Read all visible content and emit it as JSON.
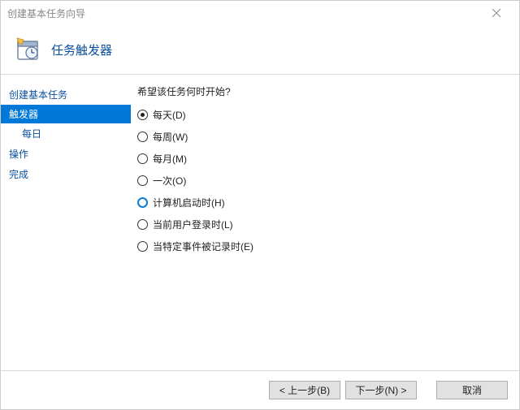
{
  "titlebar": {
    "title": "创建基本任务向导"
  },
  "header": {
    "heading": "任务触发器",
    "icon_name": "scheduled-task-icon"
  },
  "sidebar": {
    "steps": [
      {
        "label": "创建基本任务",
        "active": false,
        "sub": false
      },
      {
        "label": "触发器",
        "active": true,
        "sub": false
      },
      {
        "label": "每日",
        "active": false,
        "sub": true
      },
      {
        "label": "操作",
        "active": false,
        "sub": false
      },
      {
        "label": "完成",
        "active": false,
        "sub": false
      }
    ]
  },
  "main": {
    "prompt": "希望该任务何时开始?",
    "options": [
      {
        "label": "每天(D)",
        "checked": true,
        "hovered": false
      },
      {
        "label": "每周(W)",
        "checked": false,
        "hovered": false
      },
      {
        "label": "每月(M)",
        "checked": false,
        "hovered": false
      },
      {
        "label": "一次(O)",
        "checked": false,
        "hovered": false
      },
      {
        "label": "计算机启动时(H)",
        "checked": false,
        "hovered": true
      },
      {
        "label": "当前用户登录时(L)",
        "checked": false,
        "hovered": false
      },
      {
        "label": "当特定事件被记录时(E)",
        "checked": false,
        "hovered": false
      }
    ]
  },
  "footer": {
    "back": "< 上一步(B)",
    "next": "下一步(N) >",
    "cancel": "取消"
  }
}
